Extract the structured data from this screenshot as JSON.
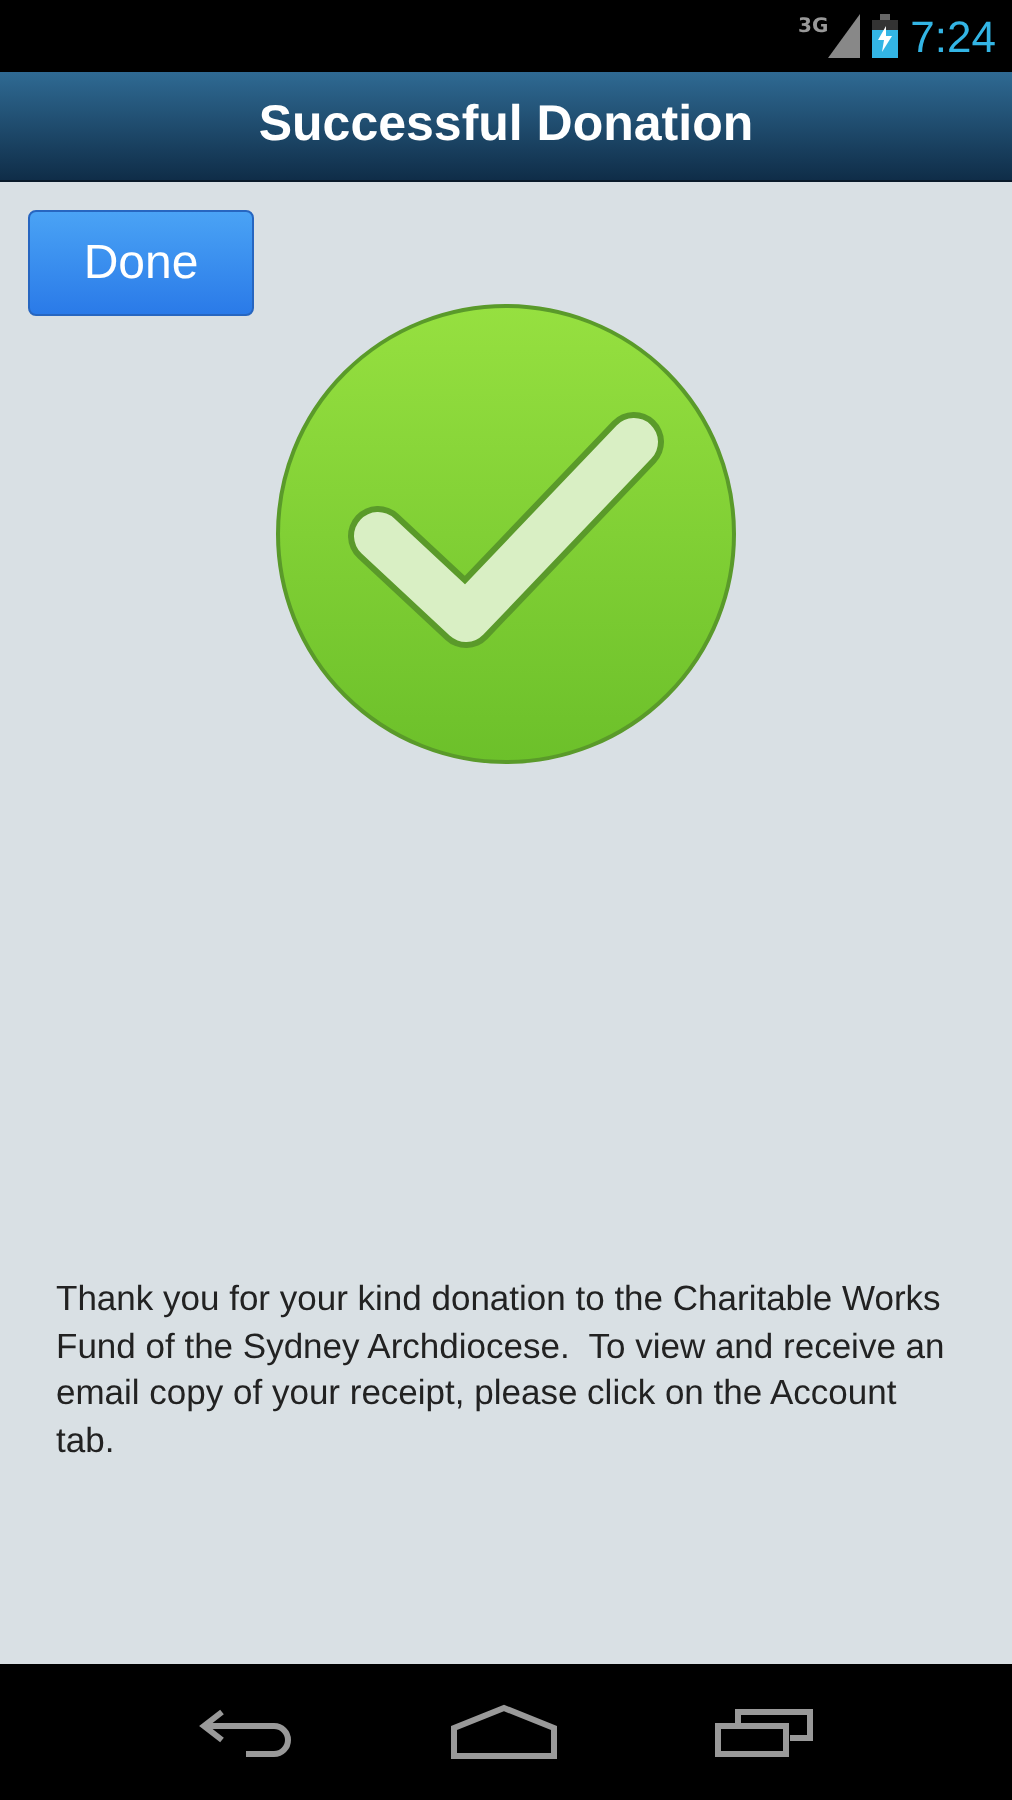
{
  "status_bar": {
    "network": "3G",
    "time": "7:24"
  },
  "header": {
    "title": "Successful Donation"
  },
  "done_button": {
    "label": "Done"
  },
  "message": "Thank you for your kind donation to the Charitable Works Fund of the Sydney Archdiocese.  To view and receive an email copy of your receipt, please click on the Account tab."
}
